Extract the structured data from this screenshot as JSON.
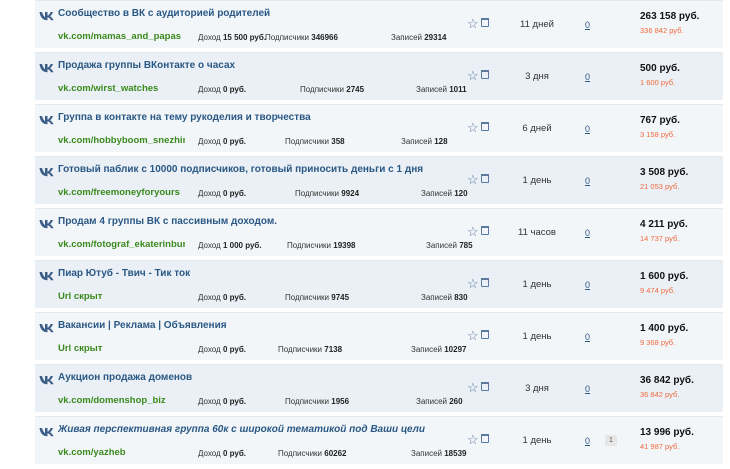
{
  "rows": [
    {
      "title": "Сообщество в ВК с аудиторией родителей",
      "url": "vk.com/mamas_and_papas",
      "income_label": "Доход",
      "income": "15 500 руб.",
      "subs_label": "Подписчики",
      "subs": "346966",
      "posts_label": "Записей",
      "posts": "29314",
      "age": "11 дней",
      "count": "0",
      "price": "263 158 руб.",
      "old_price": "336 842 руб.",
      "italic": false,
      "badge": null
    },
    {
      "title": "Продажа группы ВКонтакте о часах",
      "url": "vk.com/wirst_watches",
      "income_label": "Доход",
      "income": "0 руб.",
      "subs_label": "Подписчики",
      "subs": "2745",
      "posts_label": "Записей",
      "posts": "1011",
      "age": "3 дня",
      "count": "0",
      "price": "500 руб.",
      "old_price": "1 600 руб.",
      "italic": false,
      "badge": null
    },
    {
      "title": "Группа в контакте на тему рукоделия и творчества",
      "url": "vk.com/hobbyboom_snezhinka",
      "income_label": "Доход",
      "income": "0 руб.",
      "subs_label": "Подписчики",
      "subs": "358",
      "posts_label": "Записей",
      "posts": "128",
      "age": "6 дней",
      "count": "0",
      "price": "767 руб.",
      "old_price": "3 158 руб.",
      "italic": false,
      "badge": null
    },
    {
      "title": "Готовый паблик с 10000 подписчиков, готовый приносить деньги с 1 дня",
      "url": "vk.com/freemoneyforyours",
      "income_label": "Доход",
      "income": "0 руб.",
      "subs_label": "Подписчики",
      "subs": "9924",
      "posts_label": "Записей",
      "posts": "120",
      "age": "1 день",
      "count": "0",
      "price": "3 508 руб.",
      "old_price": "21 053 руб.",
      "italic": false,
      "badge": null
    },
    {
      "title": "Продам 4 группы ВК с пассивным доходом.",
      "url": "vk.com/fotograf_ekaterinburg",
      "income_label": "Доход",
      "income": "1 000 руб.",
      "subs_label": "Подписчики",
      "subs": "19398",
      "posts_label": "Записей",
      "posts": "785",
      "age": "11 часов",
      "count": "0",
      "price": "4 211 руб.",
      "old_price": "14 737 руб.",
      "italic": false,
      "badge": null
    },
    {
      "title": "Пиар Ютуб - Твич - Тик ток",
      "url": "Url скрыт",
      "income_label": "Доход",
      "income": "0 руб.",
      "subs_label": "Подписчики",
      "subs": "9745",
      "posts_label": "Записей",
      "posts": "830",
      "age": "1 день",
      "count": "0",
      "price": "1 600 руб.",
      "old_price": "9 474 руб.",
      "italic": false,
      "badge": null
    },
    {
      "title": "Вакансии | Реклама | Объявления",
      "url": "Url скрыт",
      "income_label": "Доход",
      "income": "0 руб.",
      "subs_label": "Подписчики",
      "subs": "7138",
      "posts_label": "Записей",
      "posts": "10297",
      "age": "1 день",
      "count": "0",
      "price": "1 400 руб.",
      "old_price": "9 368 руб.",
      "italic": false,
      "badge": null
    },
    {
      "title": "Аукцион продажа доменов",
      "url": "vk.com/domenshop_biz",
      "income_label": "Доход",
      "income": "0 руб.",
      "subs_label": "Подписчики",
      "subs": "1956",
      "posts_label": "Записей",
      "posts": "260",
      "age": "3 дня",
      "count": "0",
      "price": "36 842 руб.",
      "old_price": "36 842 руб.",
      "italic": false,
      "badge": null
    },
    {
      "title": "Живая перспективная группа 60к с широкой тематикой под Ваши цели",
      "url": "vk.com/yazheb",
      "income_label": "Доход",
      "income": "0 руб.",
      "subs_label": "Подписчики",
      "subs": "60262",
      "posts_label": "Записей",
      "posts": "18539",
      "age": "1 день",
      "count": "0",
      "price": "13 996 руб.",
      "old_price": "41 987 руб.",
      "italic": true,
      "badge": "1"
    }
  ],
  "icons": {
    "platform": "vk-logo-icon",
    "favorite": "star-icon",
    "delete": "trash-icon"
  },
  "colors": {
    "title": "#2a5885",
    "url": "#3a8a1e",
    "old_price": "#f06a3c",
    "row_bg": "#f3f6f9"
  }
}
